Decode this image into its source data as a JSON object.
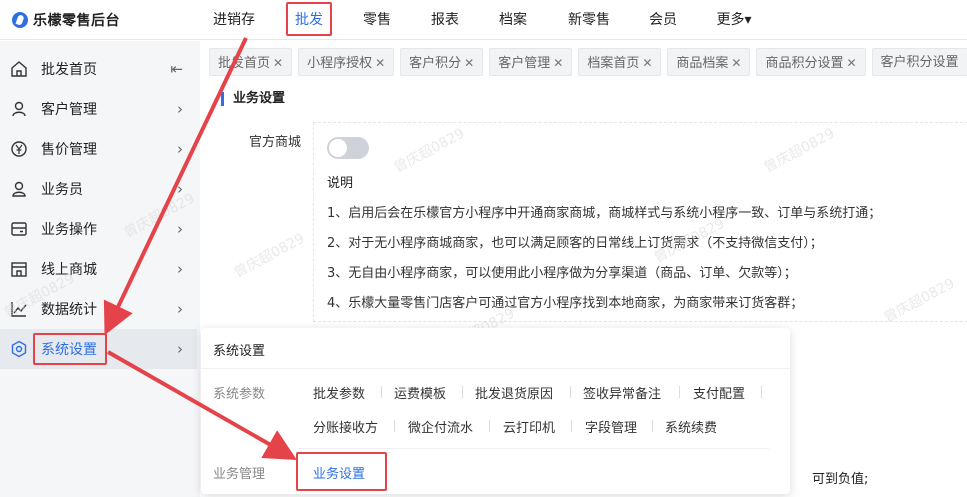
{
  "brand": {
    "name": "乐檬零售后台"
  },
  "nav": {
    "items": [
      {
        "label": "进销存"
      },
      {
        "label": "批发"
      },
      {
        "label": "零售"
      },
      {
        "label": "报表"
      },
      {
        "label": "档案"
      },
      {
        "label": "新零售"
      },
      {
        "label": "会员"
      },
      {
        "label": "更多▾"
      }
    ],
    "active_index": 1
  },
  "sidebar": {
    "items": [
      {
        "label": "批发首页",
        "icon": "home-icon",
        "arrow": "⇤"
      },
      {
        "label": "客户管理",
        "icon": "user-icon",
        "arrow": "›"
      },
      {
        "label": "售价管理",
        "icon": "price-icon",
        "arrow": "›"
      },
      {
        "label": "业务员",
        "icon": "person-icon",
        "arrow": "›"
      },
      {
        "label": "业务操作",
        "icon": "card-icon",
        "arrow": "›"
      },
      {
        "label": "线上商城",
        "icon": "store-icon",
        "arrow": "›"
      },
      {
        "label": "数据统计",
        "icon": "chart-icon",
        "arrow": "›"
      },
      {
        "label": "系统设置",
        "icon": "settings-icon",
        "arrow": "›"
      }
    ]
  },
  "tabs": [
    {
      "label": "批发首页"
    },
    {
      "label": "小程序授权"
    },
    {
      "label": "客户积分"
    },
    {
      "label": "客户管理"
    },
    {
      "label": "档案首页"
    },
    {
      "label": "商品档案"
    },
    {
      "label": "商品积分设置"
    },
    {
      "label": "客户积分设置"
    }
  ],
  "main": {
    "section_title": "业务设置",
    "field_label": "官方商城",
    "toggle_on": false,
    "desc_title": "说明",
    "desc_lines": [
      "1、启用后会在乐檬官方小程序中开通商家商城，商城样式与系统小程序一致、订单与系统打通；",
      "2、对于无小程序商城商家，也可以满足顾客的日常线上订货需求（不支持微信支付）；",
      "3、无自由小程序商家，可以使用此小程序做为分享渠道（商品、订单、欠款等）；",
      "4、乐檬大量零售门店客户可通过官方小程序找到本地商家，为商家带来订货客群；"
    ],
    "tail_text": "可到负值;"
  },
  "popup": {
    "title": "系统设置",
    "groups": [
      {
        "label": "系统参数",
        "row1": [
          "批发参数",
          "运费模板",
          "批发退货原因",
          "签收异常备注",
          "支付配置"
        ],
        "row2": [
          "分账接收方",
          "微企付流水",
          "云打印机",
          "字段管理",
          "系统续费"
        ]
      },
      {
        "label": "业务管理",
        "items": [
          "业务设置"
        ]
      }
    ]
  },
  "watermark": "曾庆超0829",
  "colors": {
    "accent": "#2f6fe4",
    "annotation": "#e5434a"
  }
}
